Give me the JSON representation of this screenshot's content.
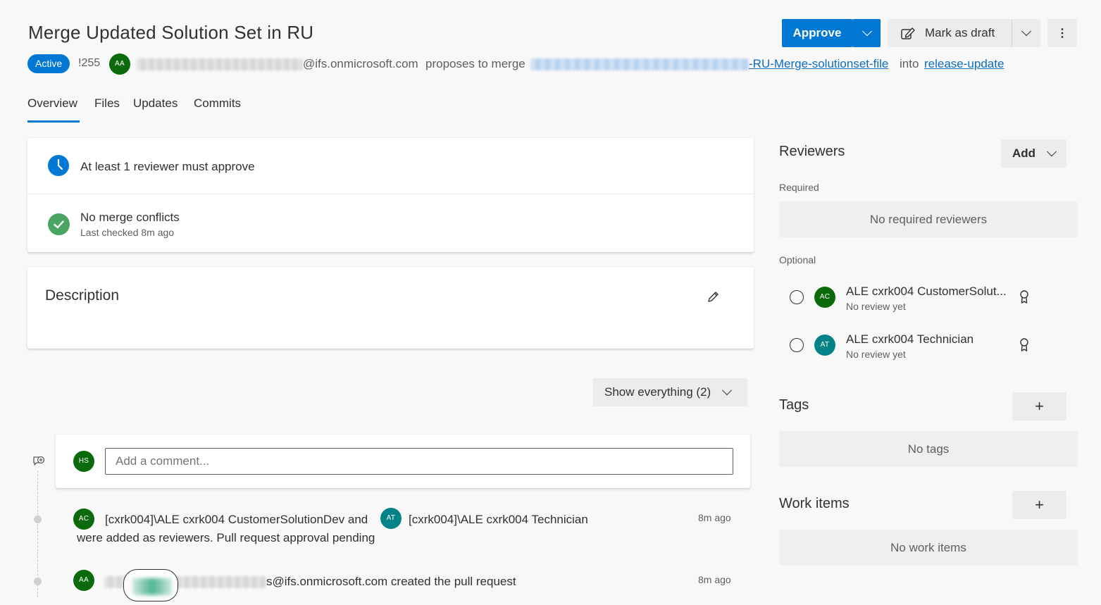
{
  "header": {
    "title": "Merge Updated Solution Set in RU",
    "status": "Active",
    "pr_id": "!255",
    "author_initials": "AA",
    "author_email_suffix": "@ifs.onmicrosoft.com",
    "proposes_text": "proposes to merge",
    "source_branch_suffix": "-RU-Merge-solutionset-file",
    "into_text": "into",
    "target_branch": "release-update",
    "approve_label": "Approve",
    "mark_draft_label": "Mark as draft"
  },
  "tabs": [
    {
      "label": "Overview"
    },
    {
      "label": "Files"
    },
    {
      "label": "Updates"
    },
    {
      "label": "Commits"
    }
  ],
  "policies": {
    "reviewer_policy": "At least 1 reviewer must approve",
    "merge_status": "No merge conflicts",
    "merge_checked": "Last checked 8m ago"
  },
  "description": {
    "title": "Description"
  },
  "filter": {
    "label": "Show everything (2)"
  },
  "comment": {
    "user_initials": "HS",
    "placeholder": "Add a comment..."
  },
  "activity": [
    {
      "initials_a": "AC",
      "name_a": "[cxrk004]\\ALE cxrk004 CustomerSolutionDev and",
      "initials_b": "AT",
      "name_b": "[cxrk004]\\ALE cxrk004 Technician",
      "line2": "were added as reviewers. Pull request approval pending",
      "time": "8m ago"
    },
    {
      "initials": "AA",
      "text": "s@ifs.onmicrosoft.com created the pull request",
      "time": "8m ago"
    }
  ],
  "reviewers": {
    "title": "Reviewers",
    "add_label": "Add",
    "required_label": "Required",
    "required_empty": "No required reviewers",
    "optional_label": "Optional",
    "optional": [
      {
        "initials": "AC",
        "name": "ALE cxrk004 CustomerSolut...",
        "status": "No review yet"
      },
      {
        "initials": "AT",
        "name": "ALE cxrk004 Technician",
        "status": "No review yet"
      }
    ]
  },
  "tags": {
    "title": "Tags",
    "add_label": "+",
    "empty": "No tags"
  },
  "work_items": {
    "title": "Work items",
    "add_label": "+",
    "empty": "No work items"
  },
  "colors": {
    "accent": "#0078d4",
    "success": "#4aa564",
    "avatar_green": "#0b6a0b",
    "avatar_teal": "#038387"
  }
}
